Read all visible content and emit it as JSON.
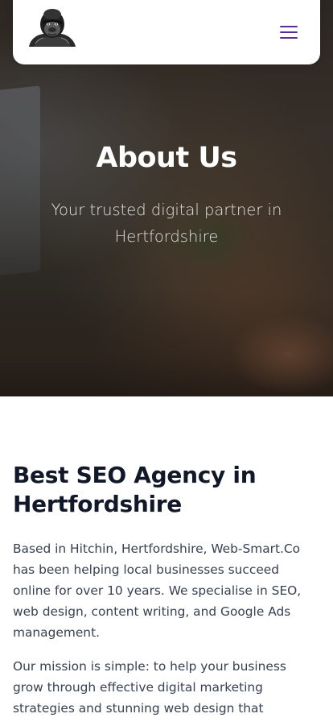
{
  "header": {
    "logo_alt": "Gorilla logo",
    "menu_icon": "hamburger-menu-icon",
    "menu_color": "#5b2d8f"
  },
  "hero": {
    "title": "About Us",
    "subtitle": "Your trusted digital partner in Hertfordshire"
  },
  "about": {
    "heading": "Best SEO Agency in Hertfordshire",
    "paragraphs": [
      "Based in Hitchin, Hertfordshire, Web-Smart.Co has been helping local businesses succeed online for over 10 years. We specialise in SEO, web design, content writing, and Google Ads management.",
      "Our mission is simple: to help your business grow through effective digital marketing strategies and stunning web design that converts visitors into"
    ]
  }
}
